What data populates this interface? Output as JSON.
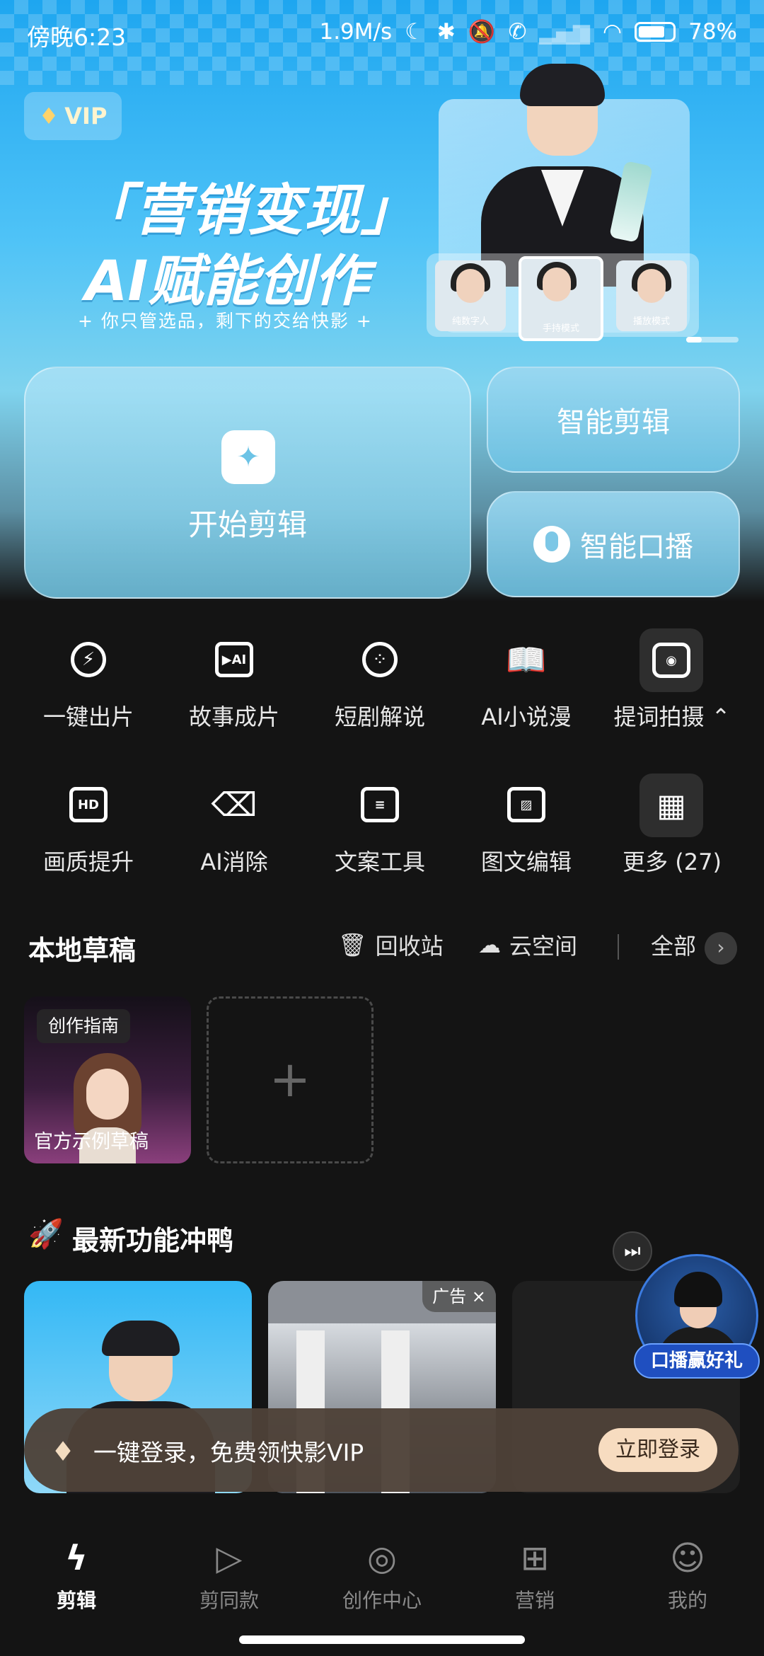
{
  "status_bar": {
    "time": "傍晚6:23",
    "speed": "1.9M/s",
    "battery": "78%",
    "battery_level": 0.78
  },
  "hero": {
    "vip_badge": "VIP",
    "slogan_line1": "「营销变现」",
    "slogan_line2": "AI赋能创作",
    "slogan_line3": "+ 你只管选品，剩下的交给快影 +",
    "thumbs": [
      "纯数字人",
      "手持模式",
      "播放模式"
    ]
  },
  "actions": {
    "start_edit": "开始剪辑",
    "smart_edit": "智能剪辑",
    "smart_voice": "智能口播"
  },
  "tools_row1": [
    {
      "label": "一键出片",
      "icon": "lightning-icon"
    },
    {
      "label": "故事成片",
      "icon": "story-video-icon"
    },
    {
      "label": "短剧解说",
      "icon": "film-reel-icon"
    },
    {
      "label": "AI小说漫",
      "icon": "book-icon"
    },
    {
      "label": "提词拍摄 ⌃",
      "icon": "camera-icon"
    }
  ],
  "tools_row2": [
    {
      "label": "画质提升",
      "icon": "hd-icon"
    },
    {
      "label": "AI消除",
      "icon": "eraser-icon"
    },
    {
      "label": "文案工具",
      "icon": "document-icon"
    },
    {
      "label": "图文编辑",
      "icon": "image-edit-icon"
    },
    {
      "label": "更多 (27)",
      "icon": "grid-icon"
    }
  ],
  "drafts": {
    "title": "本地草稿",
    "recycle": "回收站",
    "cloud": "云空间",
    "all": "全部",
    "card_tag": "创作指南",
    "card_title": "官方示例草稿"
  },
  "features": {
    "title": "最新功能冲鸭",
    "ad_label": "广告 ×",
    "host_label": "口播赢好礼"
  },
  "login": {
    "text": "一键登录，免费领快影VIP",
    "button": "立即登录"
  },
  "nav": [
    {
      "label": "剪辑",
      "active": true
    },
    {
      "label": "剪同款",
      "active": false
    },
    {
      "label": "创作中心",
      "active": false
    },
    {
      "label": "营销",
      "active": false
    },
    {
      "label": "我的",
      "active": false
    }
  ]
}
